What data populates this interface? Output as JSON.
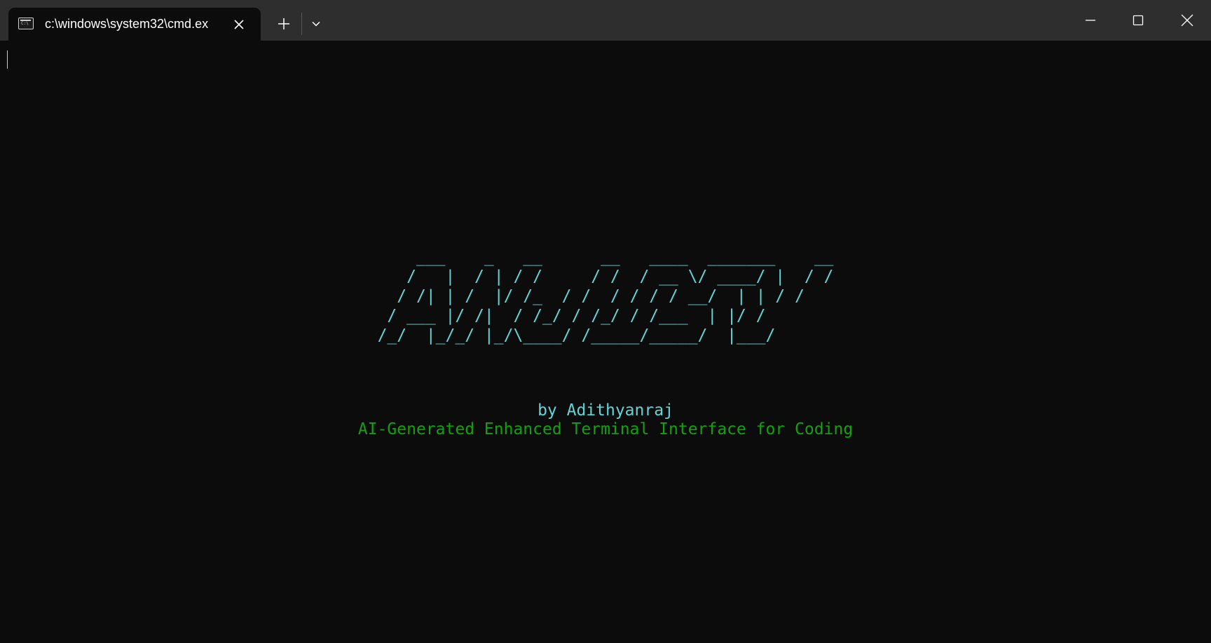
{
  "window": {
    "tab_title": "c:\\windows\\system32\\cmd.ex",
    "tab_icon": "console-icon",
    "controls": {
      "new_tab_icon": "plus-icon",
      "dropdown_icon": "chevron-down-icon",
      "minimize_icon": "minimize-icon",
      "maximize_icon": "maximize-icon",
      "close_icon": "close-icon"
    }
  },
  "terminal": {
    "banner_ascii": "    ___    _   __      __   ____  _______    __\n   /   |  / | / /     / /  / __ \\/ ____/ |  / /\n  / /| | /  |/ /_  / /  / / / / __/  | | / / \n / ___ |/ /|  / /_/ / /_/ / /___  | |/ /  \n/_/  |_/_/ |_/\\____/ /_____/_____/  |___/   ",
    "byline": "by Adithyanraj",
    "subtitle": "AI-Generated Enhanced Terminal Interface for Coding"
  },
  "colors": {
    "background": "#0c0c0c",
    "titlebar": "#2e2e2e",
    "banner_cyan": "#61d6d6",
    "subtitle_green": "#13a10e"
  }
}
